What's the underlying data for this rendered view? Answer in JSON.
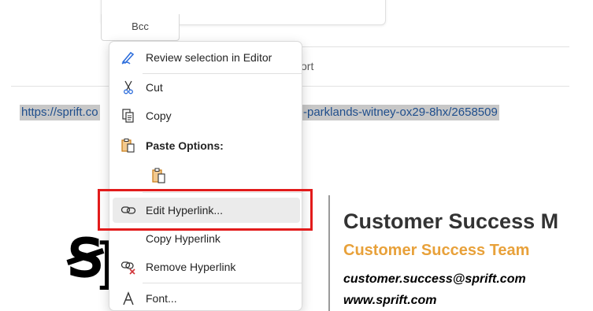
{
  "compose": {
    "bcc_label": "Bcc",
    "report_fragment": "ort"
  },
  "message": {
    "url_left": "https://sprift.co",
    "url_right": "-parklands-witney-ox29-8hx/2658509"
  },
  "signature": {
    "name": "Customer Success M",
    "team": "Customer Success Team",
    "email": "customer.success@sprift.com",
    "web": "www.sprift.com"
  },
  "context_menu": {
    "review": "Review selection in Editor",
    "cut": "Cut",
    "copy": "Copy",
    "paste_options": "Paste Options:",
    "edit_hyperlink": "Edit Hyperlink...",
    "copy_hyperlink": "Copy Hyperlink",
    "remove_hyperlink": "Remove Hyperlink",
    "font": "Font..."
  },
  "colors": {
    "highlight_border": "#e21b1b",
    "accent_orange": "#e8a13a",
    "editor_blue": "#2f6fdc"
  }
}
